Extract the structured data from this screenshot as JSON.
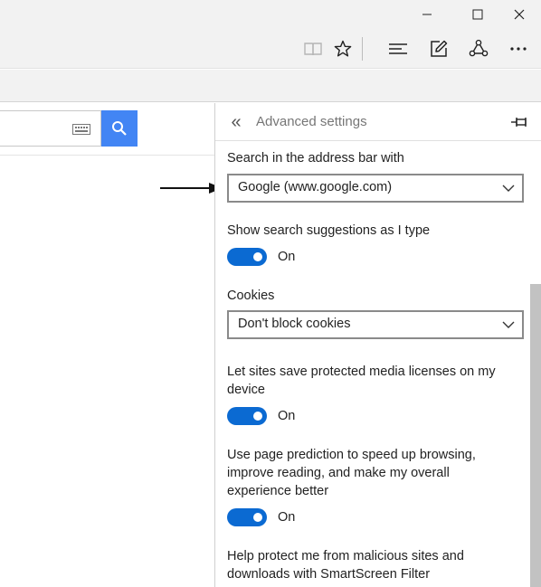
{
  "window": {
    "minimize_icon": "minimize-icon",
    "maximize_icon": "maximize-icon",
    "close_icon": "close-icon"
  },
  "toolbar": {
    "icons": [
      "reading-view-icon",
      "favorite-star-icon",
      "hub-icon",
      "web-note-icon",
      "share-icon",
      "more-icon"
    ]
  },
  "page": {
    "keyboard_icon": "keyboard-icon",
    "search_icon": "search-icon",
    "search_button_color": "#4285f4"
  },
  "settings_panel": {
    "title": "Advanced settings",
    "search_engine": {
      "label": "Search in the address bar with",
      "value": "Google (www.google.com)"
    },
    "search_suggestions": {
      "label": "Show search suggestions as I type",
      "state": "On"
    },
    "cookies": {
      "label": "Cookies",
      "value": "Don't block cookies"
    },
    "media_licenses": {
      "label": "Let sites save protected media licenses on my device",
      "state": "On"
    },
    "page_prediction": {
      "label": "Use page prediction to speed up browsing, improve reading, and make my overall experience better",
      "state": "On"
    },
    "smartscreen": {
      "label": "Help protect me from malicious sites and downloads with SmartScreen Filter"
    },
    "toggle_color": "#0b6ad2"
  }
}
